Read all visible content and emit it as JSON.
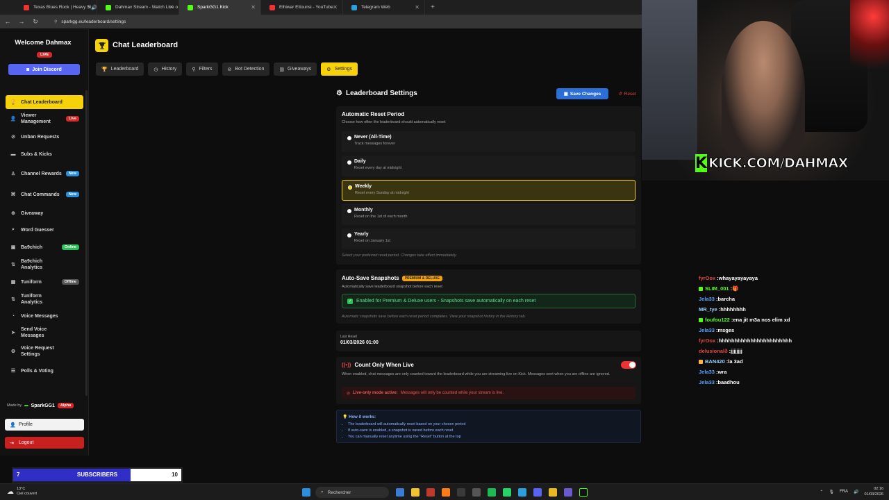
{
  "browser": {
    "tabs": [
      {
        "title": "Texas Blues Rock | Heavy Sl",
        "color": "#e33",
        "active": false,
        "audio": true
      },
      {
        "title": "Dahmax Stream - Watch Live o",
        "color": "#53fc18",
        "active": false,
        "audio": false
      },
      {
        "title": "SparkGG1 Kick",
        "color": "#53fc18",
        "active": true,
        "audio": false
      },
      {
        "title": "Elhiwar Ettounsi - YouTube",
        "color": "#e33",
        "active": false,
        "audio": false
      },
      {
        "title": "Telegram Web",
        "color": "#2aa1da",
        "active": false,
        "audio": false
      }
    ],
    "url": "sparkgg.eu/leaderboard/settings"
  },
  "sidebar": {
    "welcome": "Welcome Dahmax",
    "live_badge": "LIVE",
    "join_discord": "Join Discord",
    "items": [
      {
        "label": "Chat Leaderboard",
        "icon": "🏆",
        "active": true
      },
      {
        "label": "Viewer Management",
        "icon": "👤",
        "badge": "Live",
        "badge_color": "#d62828"
      },
      {
        "label": "Unban Requests",
        "icon": "⊘"
      },
      {
        "label": "Subs & Kicks",
        "icon": "▬"
      },
      {
        "label": "Channel Rewards",
        "icon": "♙",
        "badge": "New",
        "badge_color": "#2b8fe0"
      },
      {
        "label": "Chat Commands",
        "icon": "⌘",
        "badge": "New",
        "badge_color": "#2b8fe0"
      },
      {
        "label": "Giveaway",
        "icon": "⊕"
      },
      {
        "label": "Word Guesser",
        "icon": "⌕"
      },
      {
        "label": "Ba9chich",
        "icon": "▣",
        "badge": "Online",
        "badge_color": "#2fbf5a"
      },
      {
        "label": "Ba9chich Analytics",
        "icon": "⇅"
      },
      {
        "label": "Tuniform",
        "icon": "▦",
        "badge": "Offline",
        "badge_color": "#555"
      },
      {
        "label": "Tuniform Analytics",
        "icon": "⇅"
      },
      {
        "label": "Voice Messages",
        "icon": "◔"
      },
      {
        "label": "Send Voice Messages",
        "icon": "➤"
      },
      {
        "label": "Voice Request Settings",
        "icon": "⚙"
      },
      {
        "label": "Polls & Voting",
        "icon": "☰"
      }
    ],
    "made_by": "Made by",
    "brand": "SparkGG1",
    "alpha": "Alpha",
    "profile": "Profile",
    "logout": "Logout"
  },
  "header": {
    "title": "Chat Leaderboard",
    "tabs": [
      {
        "label": "Leaderboard",
        "icon": "🏆",
        "active": false
      },
      {
        "label": "History",
        "icon": "◷",
        "active": false
      },
      {
        "label": "Filters",
        "icon": "⚲",
        "active": false
      },
      {
        "label": "Bot Detection",
        "icon": "⊘",
        "active": false
      },
      {
        "label": "Giveaways",
        "icon": "▥",
        "active": false
      },
      {
        "label": "Settings",
        "icon": "⚙",
        "active": true
      }
    ]
  },
  "settings": {
    "title": "Leaderboard Settings",
    "save": "Save Changes",
    "reset": "Reset",
    "reset_period": {
      "title": "Automatic Reset Period",
      "subtitle": "Choose how often the leaderboard should automatically reset",
      "options": [
        {
          "label": "Never (All-Time)",
          "desc": "Track messages forever",
          "selected": false
        },
        {
          "label": "Daily",
          "desc": "Reset every day at midnight",
          "selected": false
        },
        {
          "label": "Weekly",
          "desc": "Reset every Sunday at midnight",
          "selected": true
        },
        {
          "label": "Monthly",
          "desc": "Reset on the 1st of each month",
          "selected": false
        },
        {
          "label": "Yearly",
          "desc": "Reset on January 1st",
          "selected": false
        }
      ],
      "note": "Select your preferred reset period. Changes take effect immediately."
    },
    "snapshots": {
      "title": "Auto-Save Snapshots",
      "badge": "PREMIUM & DELUXE",
      "subtitle": "Automatically save leaderboard snapshot before each reset",
      "enabled_text": "Enabled for Premium & Deluxe users - Snapshots save automatically on each reset",
      "note": "Automatic snapshots save before each reset period completes. View your snapshot history in the History tab."
    },
    "last_reset": {
      "label": "Last Reset",
      "value": "01/03/2026 01:00"
    },
    "count_live": {
      "title": "Count Only When Live",
      "desc": "When enabled, chat messages are only counted toward the leaderboard while you are streaming live on Kick. Messages sent when you are offline are ignored.",
      "toggle_on": true,
      "alert_strong": "Live-only mode active:",
      "alert_text": "Messages will only be counted while your stream is live."
    },
    "how_it_works": {
      "title": "How it works:",
      "items": [
        "The leaderboard will automatically reset based on your chosen period",
        "If auto-save is enabled, a snapshot is saved before each reset",
        "You can manually reset anytime using the \"Reset\" button at the top"
      ]
    }
  },
  "overlay": {
    "kick_banner": "KICK.COM/DAHMAX",
    "kick_letter": "K",
    "chat": [
      {
        "user": "fyrOox",
        "msg": "whayayayayaya",
        "color": "#e04848",
        "badge": ""
      },
      {
        "user": "SLIM_001",
        "msg": "🎁",
        "color": "#53fc18",
        "badge": "#53fc18"
      },
      {
        "user": "Jela33",
        "msg": "barcha",
        "color": "#5aa0ff",
        "badge": ""
      },
      {
        "user": "MR_tye",
        "msg": "hhhhhhhh",
        "color": "#9ad0ff",
        "badge": ""
      },
      {
        "user": "foufou122",
        "msg": "ena jit m3a nos elim xd",
        "color": "#53fc18",
        "badge": "#53fc18"
      },
      {
        "user": "Jela33",
        "msg": "msges",
        "color": "#5aa0ff",
        "badge": ""
      },
      {
        "user": "fyrOox",
        "msg": "hhhhhhhhhhhhhhhhhhhhhhh",
        "color": "#e04848",
        "badge": ""
      },
      {
        "user": "delusionalð",
        "msg": "jjjjjjjj",
        "color": "#e04848",
        "badge": ""
      },
      {
        "user": "BAN420",
        "msg": "la 3ad",
        "color": "#9ad0ff",
        "badge": "#ffb347"
      },
      {
        "user": "Jela33",
        "msg": "wra",
        "color": "#5aa0ff",
        "badge": ""
      },
      {
        "user": "Jela33",
        "msg": "baadhou",
        "color": "#5aa0ff",
        "badge": ""
      }
    ],
    "subs": {
      "left": "7",
      "label": "SUBSCRIBERS",
      "right": "10",
      "progress": 0.7
    }
  },
  "taskbar": {
    "weather_temp": "13°C",
    "weather_desc": "Ciel couvert",
    "search": "Rechercher",
    "lang": "FRA",
    "time": "02:16",
    "date": "01/03/2026"
  }
}
